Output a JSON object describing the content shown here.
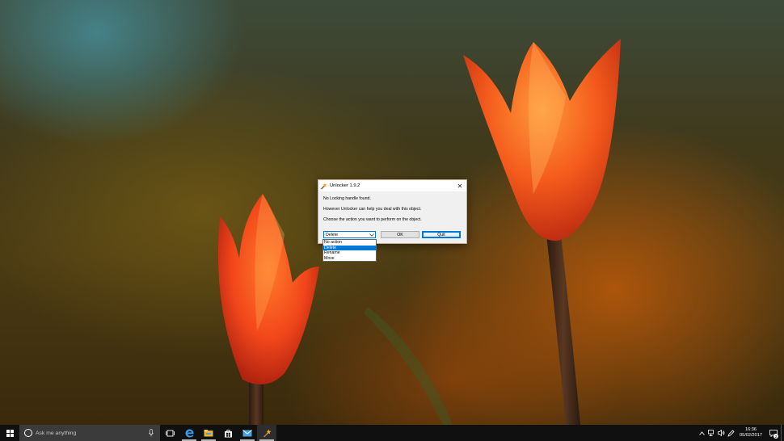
{
  "dialog": {
    "title": "Unlocker 1.9.2",
    "close_glyph": "✕",
    "message_1": "No Locking handle found.",
    "message_2": "However Unlocker can help you deal with this object.",
    "message_3": "Choose the action you want to perform on the object.",
    "action_select": {
      "selected": "Delete",
      "options": [
        "No action",
        "Delete",
        "Rename",
        "Move"
      ],
      "highlighted_index": 1
    },
    "ok_label": "OK",
    "quit_label": "Quit"
  },
  "taskbar": {
    "search_placeholder": "Ask me anything",
    "pinned": [
      {
        "name": "task-view-icon",
        "running": false
      },
      {
        "name": "edge-icon",
        "running": true
      },
      {
        "name": "file-explorer-icon",
        "running": true
      },
      {
        "name": "store-icon",
        "running": false
      },
      {
        "name": "mail-icon",
        "running": true
      },
      {
        "name": "unlocker-icon",
        "running": true,
        "active": true
      }
    ],
    "tray": {
      "time": "16:36",
      "date": "05/02/2017",
      "notification_count": "2"
    }
  },
  "colors": {
    "accent": "#0078d7",
    "taskbar_bg": "#101010",
    "search_bg": "#3b3b3b",
    "dialog_bg": "#f0f0f0"
  }
}
